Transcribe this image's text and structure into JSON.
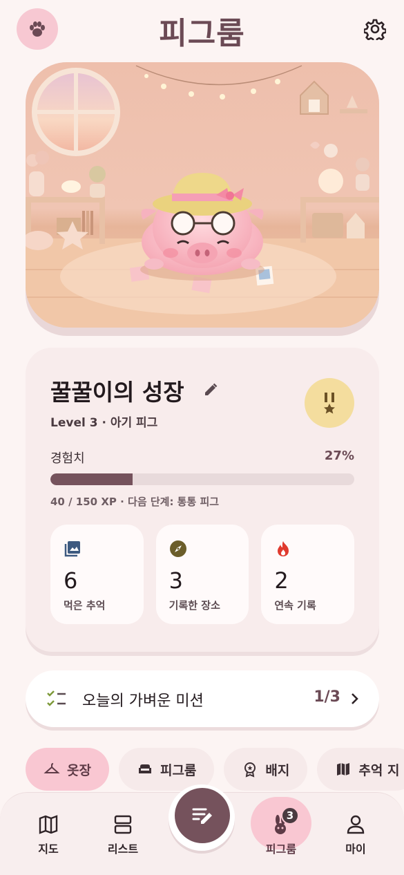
{
  "header": {
    "title": "피그룸"
  },
  "growth": {
    "title": "꿀꿀이의 성장",
    "level": "Level 3 · 아기 피그",
    "xp_label": "경험치",
    "xp_percent": "27%",
    "xp_fraction": 0.27,
    "xp_detail": "40 / 150 XP · 다음 단계: 통통 피그",
    "stats": [
      {
        "value": "6",
        "label": "먹은 추억",
        "icon": "photo-album-icon",
        "color": "#3d5a80"
      },
      {
        "value": "3",
        "label": "기록한 장소",
        "icon": "compass-icon",
        "color": "#6b5d2a"
      },
      {
        "value": "2",
        "label": "연속 기록",
        "icon": "flame-icon",
        "color": "#e03a2e"
      }
    ]
  },
  "mission": {
    "label": "오늘의 가벼운 미션",
    "count": "1/3"
  },
  "chips": [
    {
      "label": "옷장",
      "icon": "hanger-icon"
    },
    {
      "label": "피그룸",
      "icon": "sofa-icon"
    },
    {
      "label": "배지",
      "icon": "badge-icon"
    },
    {
      "label": "추억 지",
      "icon": "map-icon"
    }
  ],
  "nav": [
    {
      "label": "지도",
      "icon": "map-icon"
    },
    {
      "label": "리스트",
      "icon": "list-icon"
    },
    {
      "label": "피그룸",
      "icon": "rabbit-icon",
      "badge": "3"
    },
    {
      "label": "마이",
      "icon": "person-icon"
    }
  ],
  "colors": {
    "accent": "#75525c",
    "pink": "#f9c7d2",
    "background": "#fcf4f3"
  }
}
